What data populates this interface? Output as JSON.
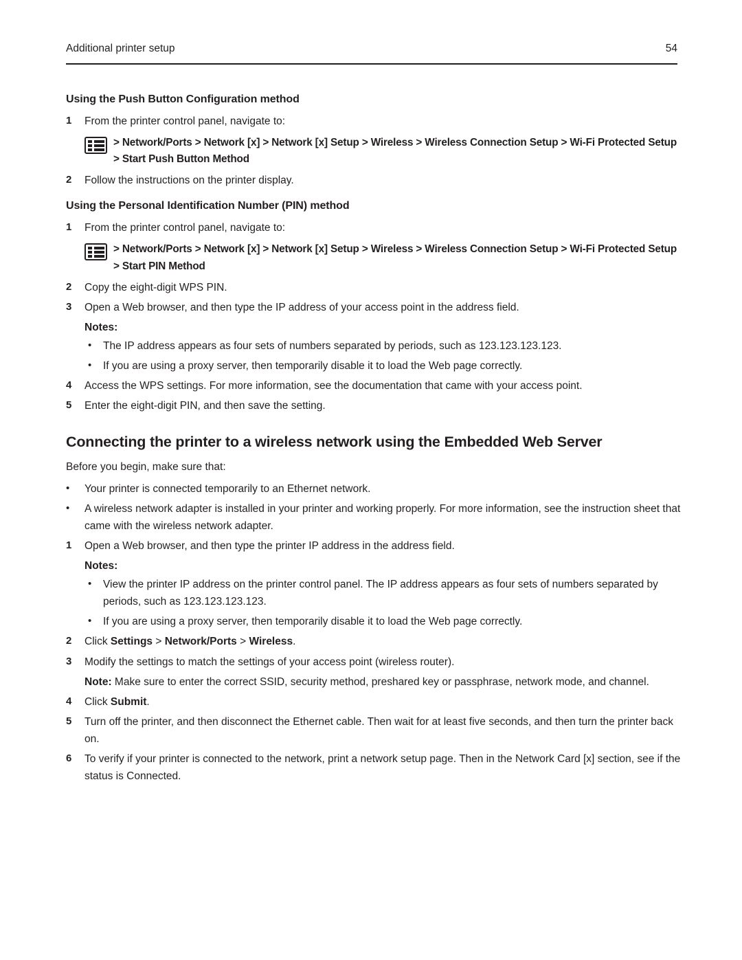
{
  "header": {
    "section_title": "Additional printer setup",
    "page_number": "54"
  },
  "sections": {
    "pbc": {
      "heading": "Using the Push Button Configuration method",
      "step1_num": "1",
      "step1_text": "From the printer control panel, navigate to:",
      "nav_path": "> Network/Ports > Network [x] > Network [x] Setup > Wireless > Wireless Connection Setup > Wi-Fi Protected Setup > Start Push Button Method",
      "icon_name": "control-panel-menu-icon",
      "step2_num": "2",
      "step2_text": "Follow the instructions on the printer display."
    },
    "pin": {
      "heading": "Using the Personal Identification Number (PIN) method",
      "step1_num": "1",
      "step1_text": "From the printer control panel, navigate to:",
      "nav_path": "> Network/Ports > Network [x] > Network [x] Setup > Wireless > Wireless Connection Setup > Wi-Fi Protected Setup > Start PIN Method",
      "icon_name": "control-panel-menu-icon",
      "step2_num": "2",
      "step2_text": "Copy the eight-digit WPS PIN.",
      "step3_num": "3",
      "step3_text": "Open a Web browser, and then type the IP address of your access point in the address field.",
      "notes_label": "Notes:",
      "note1": "The IP address appears as four sets of numbers separated by periods, such as 123.123.123.123.",
      "note2": "If you are using a proxy server, then temporarily disable it to load the Web page correctly.",
      "step4_num": "4",
      "step4_text": "Access the WPS settings. For more information, see the documentation that came with your access point.",
      "step5_num": "5",
      "step5_text": "Enter the eight-digit PIN, and then save the setting."
    },
    "ews": {
      "heading": "Connecting the printer to a wireless network using the Embedded Web Server",
      "intro": "Before you begin, make sure that:",
      "bullet1": "Your printer is connected temporarily to an Ethernet network.",
      "bullet2": "A wireless network adapter is installed in your printer and working properly. For more information, see the instruction sheet that came with the wireless network adapter.",
      "step1_num": "1",
      "step1_text": "Open a Web browser, and then type the printer IP address in the address field.",
      "notes_label": "Notes:",
      "note1": "View the printer IP address on the printer control panel. The IP address appears as four sets of numbers separated by periods, such as 123.123.123.123.",
      "note2": "If you are using a proxy server, then temporarily disable it to load the Web page correctly.",
      "step2_num": "2",
      "step2_prefix": "Click ",
      "step2_bold1": "Settings",
      "step2_sep1": " > ",
      "step2_bold2": "Network/Ports",
      "step2_sep2": " > ",
      "step2_bold3": "Wireless",
      "step2_suffix": ".",
      "step3_num": "3",
      "step3_text": "Modify the settings to match the settings of your access point (wireless router).",
      "note_label": "Note:",
      "note_text": " Make sure to enter the correct SSID, security method, preshared key or passphrase, network mode, and channel.",
      "step4_num": "4",
      "step4_prefix": "Click ",
      "step4_bold": "Submit",
      "step4_suffix": ".",
      "step5_num": "5",
      "step5_text": "Turn off the printer, and then disconnect the Ethernet cable. Then wait for at least five seconds, and then turn the printer back on.",
      "step6_num": "6",
      "step6_text": "To verify if your printer is connected to the network, print a network setup page. Then in the Network Card [x] section, see if the status is Connected."
    }
  },
  "bullet_glyph": "•"
}
